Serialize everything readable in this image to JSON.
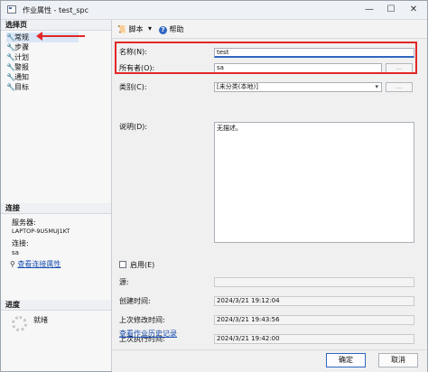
{
  "window": {
    "title": "作业属性 - test_spc",
    "minimize": "—",
    "maximize": "☐",
    "close": "✕"
  },
  "left": {
    "select_page_header": "选择页",
    "pages": [
      {
        "label": "常规",
        "icon": "wrench-icon"
      },
      {
        "label": "步骤",
        "icon": "wrench-icon"
      },
      {
        "label": "计划",
        "icon": "wrench-icon"
      },
      {
        "label": "警报",
        "icon": "wrench-icon"
      },
      {
        "label": "通知",
        "icon": "wrench-icon"
      },
      {
        "label": "目标",
        "icon": "wrench-icon"
      }
    ],
    "connection_header": "连接",
    "server_label": "服务器:",
    "server_value": "LAPTOP-9U5MUJ1KT",
    "connection_label": "连接:",
    "connection_value": "sa",
    "view_conn_props": "查看连接属性",
    "progress_header": "进度",
    "progress_status": "就绪"
  },
  "toolbar": {
    "script": "脚本",
    "dropdown": "▾",
    "help": "帮助"
  },
  "form": {
    "name_label": "名称(N):",
    "name_value": "test",
    "owner_label": "所有者(O):",
    "owner_value": "sa",
    "owner_button": "...",
    "category_label": "类别(C):",
    "category_value": "[未分类(本地)]",
    "category_button": "...",
    "description_label": "说明(D):",
    "description_value": "无描述。",
    "enabled_label": "启用(E)",
    "source_label": "源:",
    "source_value": "",
    "created_label": "创建时间:",
    "created_value": "2024/3/21  19:12:04",
    "modified_label": "上次修改时间:",
    "modified_value": "2024/3/21  19:43:56",
    "executed_label": "上次执行时间:",
    "executed_value": "2024/3/21  19:42:00",
    "history_link": "查看作业历史记录"
  },
  "buttons": {
    "ok": "确定",
    "cancel": "取消"
  },
  "colors": {
    "highlight_red": "#e32727",
    "link_blue": "#1a4fb0",
    "accent_blue": "#2f66c2"
  }
}
